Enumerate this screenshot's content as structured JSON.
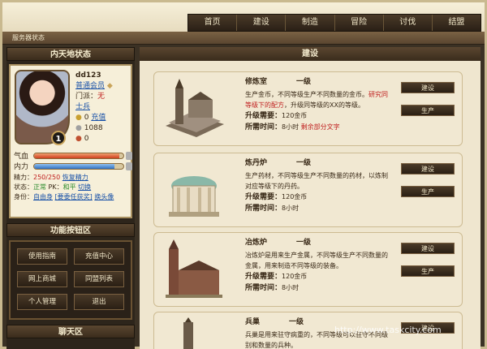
{
  "nav": [
    "首页",
    "建设",
    "制造",
    "冒险",
    "讨伐",
    "结盟"
  ],
  "status_bar": "服务器状态",
  "left": {
    "header": "内天地状态",
    "char": {
      "name": "dd123",
      "member": "普通会员",
      "faction_label": "门派：",
      "faction_value": "无",
      "rank": "士兵",
      "coin_value": "0",
      "recharge": "充值",
      "silver": "1088",
      "other": "0",
      "level": "1"
    },
    "bars": {
      "qixue_label": "气血",
      "neili_label": "内力",
      "qixue_fill": 0.95,
      "neili_fill": 0.9
    },
    "stats": {
      "jingli_label": "精力：",
      "jingli_value": "250/250",
      "jingli_link": "恢复精力",
      "state_label": "状态：",
      "state_value": "正常",
      "pk_label": "PK：",
      "pk_value": "和平",
      "pk_switch": "切换",
      "identity_label": "身份：",
      "identity_value": "自由身",
      "identity_link": "[要委任获奖]",
      "identity_change": "换头像"
    },
    "func_header": "功能按钮区",
    "func_buttons": [
      "使用指南",
      "充值中心",
      "网上商城",
      "同盟列表",
      "个人管理",
      "退出"
    ],
    "chat_header": "聊天区"
  },
  "main": {
    "header": "建设",
    "cards": [
      {
        "name": "修炼室",
        "level": "一级",
        "desc_a": "生产金币，不同等级生产不同数量的金币。",
        "desc_b": "研究同等级下的配方",
        "desc_c": "，升级同等级的XX的等级。",
        "cost_label": "升级需要：",
        "cost_value": "120金币",
        "time_label": "所需时间：",
        "time_value": "8小时",
        "time_extra": "剩余部分文字",
        "btn_build": "建设",
        "btn_produce": "生产"
      },
      {
        "name": "炼丹炉",
        "level": "一级",
        "desc_a": "生产药材，不同等级生产不同数量的药材，以炼制对应等级下的丹药。",
        "desc_b": "",
        "desc_c": "",
        "cost_label": "升级需要：",
        "cost_value": "120金币",
        "time_label": "所需时间：",
        "time_value": "8小时",
        "time_extra": "",
        "btn_build": "建设",
        "btn_produce": "生产"
      },
      {
        "name": "冶炼炉",
        "level": "一级",
        "desc_a": "冶炼炉是用来生产金属，不同等级生产不同数量的金属，用来制造不同等级的装备。",
        "desc_b": "",
        "desc_c": "",
        "cost_label": "升级需要：",
        "cost_value": "120金币",
        "time_label": "所需时间：",
        "time_value": "8小时",
        "time_extra": "",
        "btn_build": "建设",
        "btn_produce": "生产"
      },
      {
        "name": "兵巢",
        "level": "一级",
        "desc_a": "兵巢是用来驻守病重的，不同等级可以驻守不同级别和数量的兵种。",
        "desc_b": "",
        "desc_c": "",
        "cost_label": "",
        "cost_value": "",
        "time_label": "",
        "time_value": "",
        "time_extra": "",
        "btn_build": "建设",
        "btn_produce": ""
      }
    ]
  },
  "watermark": "http://www.taskcity.com"
}
